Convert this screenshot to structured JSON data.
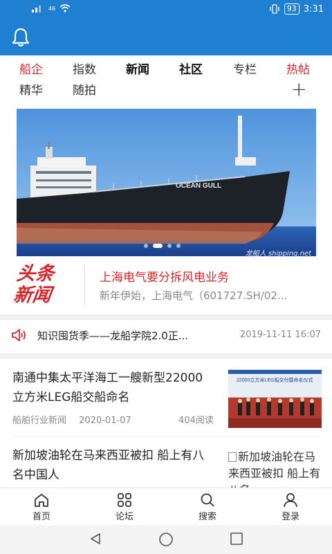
{
  "status_bar": {
    "signal": "46",
    "battery": "93",
    "time": "3:31"
  },
  "app_bar": {
    "icon": "bell-icon"
  },
  "tabs": {
    "row1": [
      {
        "label": "船企",
        "color": "#d6262d"
      },
      {
        "label": "指数"
      },
      {
        "label": "新闻",
        "active": true
      },
      {
        "label": "社区",
        "active": true
      },
      {
        "label": "专栏"
      },
      {
        "label": "热帖",
        "color": "#d6262d"
      }
    ],
    "row2": [
      {
        "label": "精华"
      },
      {
        "label": "随拍"
      }
    ],
    "add_icon": "+"
  },
  "banner": {
    "ship_name": "OCEAN GULL",
    "watermark": "龙船人 shipping.net",
    "dots_count": 4,
    "active_dot": 1
  },
  "headline": {
    "logo_line1": "头条",
    "logo_line2": "新闻",
    "title": "上海电气要分拆风电业务",
    "subtitle": "新年伊始，上海电气（601727.SH/02..."
  },
  "notice": {
    "icon": "speaker-icon",
    "text": "知识囤货季——龙船学院2.0正...",
    "time": "2019-11-11 16:07"
  },
  "articles": [
    {
      "title": "南通中集太平洋海工一艘新型22000立方米LEG船交船命名",
      "source": "船舶行业新闻",
      "date": "2020-01-07",
      "reads": "404阅读",
      "thumb_banner_text": "22000立方米LEG船交付暨命名仪式"
    },
    {
      "title": "新加坡油轮在马来西亚被扣 船上有八名中国人",
      "thumb_alt": "新加坡油轮在马来西亚被扣 船上有八名"
    }
  ],
  "bottom_nav": [
    {
      "label": "首页",
      "icon": "home-icon"
    },
    {
      "label": "论坛",
      "icon": "forum-grid-icon"
    },
    {
      "label": "搜索",
      "icon": "search-icon"
    },
    {
      "label": "登录",
      "icon": "user-icon"
    }
  ],
  "colors": {
    "brand_blue": "#1f7fd1",
    "accent_red": "#d6262d"
  }
}
